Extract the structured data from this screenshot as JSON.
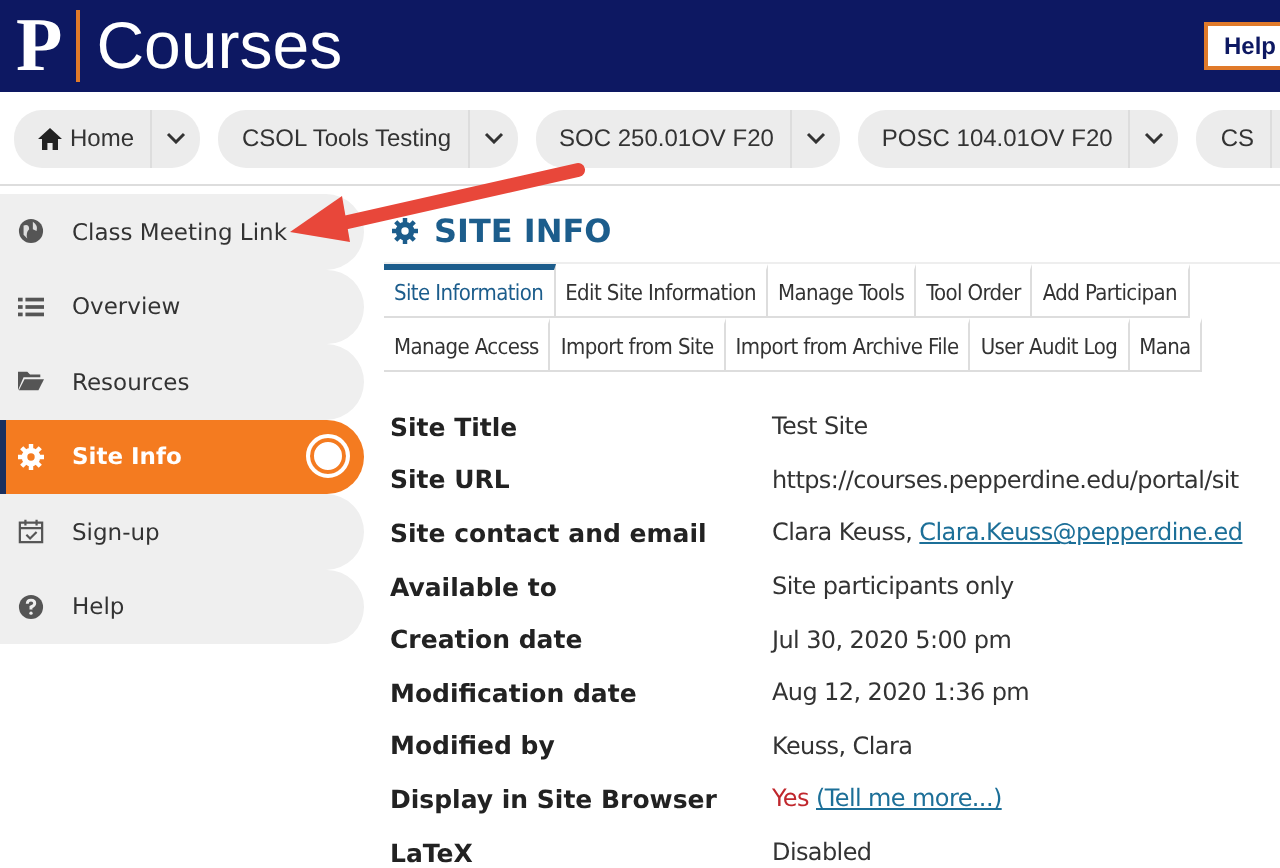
{
  "header": {
    "logo_letter": "P",
    "title": "Courses",
    "help_button": "Help"
  },
  "breadcrumbs": [
    {
      "label": "Home",
      "kind": "home"
    },
    {
      "label": "CSOL Tools Testing",
      "kind": "site"
    },
    {
      "label": "SOC 250.01OV F20",
      "kind": "site"
    },
    {
      "label": "POSC 104.01OV F20",
      "kind": "site"
    },
    {
      "label": "CS",
      "kind": "site"
    }
  ],
  "sidebar": {
    "items": [
      {
        "label": "Class Meeting Link",
        "kind": "globe",
        "selected": false
      },
      {
        "label": "Overview",
        "kind": "list",
        "selected": false
      },
      {
        "label": "Resources",
        "kind": "folder",
        "selected": false
      },
      {
        "label": "Site Info",
        "kind": "gear",
        "selected": true
      },
      {
        "label": "Sign-up",
        "kind": "calendar",
        "selected": false
      },
      {
        "label": "Help",
        "kind": "question",
        "selected": false
      }
    ]
  },
  "page": {
    "title": "SITE INFO",
    "tab_rows": [
      [
        {
          "label": "Site Information",
          "selected": true
        },
        {
          "label": "Edit Site Information",
          "selected": false
        },
        {
          "label": "Manage Tools",
          "selected": false
        },
        {
          "label": "Tool Order",
          "selected": false
        },
        {
          "label": "Add Participan",
          "selected": false
        }
      ],
      [
        {
          "label": "Manage Access",
          "selected": false
        },
        {
          "label": "Import from Site",
          "selected": false
        },
        {
          "label": "Import from Archive File",
          "selected": false
        },
        {
          "label": "User Audit Log",
          "selected": false
        },
        {
          "label": "Mana",
          "selected": false
        }
      ]
    ],
    "details": [
      {
        "label": "Site Title",
        "kind": "text",
        "value": "Test Site"
      },
      {
        "label": "Site URL",
        "kind": "text",
        "value": "https://courses.pepperdine.edu/portal/sit"
      },
      {
        "label": "Site contact and email",
        "kind": "contact",
        "value": "Clara Keuss,",
        "link": "Clara.Keuss@pepperdine.ed"
      },
      {
        "label": "Available to",
        "kind": "text",
        "value": "Site participants only"
      },
      {
        "label": "Creation date",
        "kind": "text",
        "value": "Jul 30, 2020 5:00 pm"
      },
      {
        "label": "Modification date",
        "kind": "text",
        "value": "Aug 12, 2020 1:36 pm"
      },
      {
        "label": "Modified by",
        "kind": "text",
        "value": "Keuss, Clara"
      },
      {
        "label": "Display in Site Browser",
        "kind": "flag",
        "value": "Yes",
        "link": "(Tell me more...)"
      },
      {
        "label": "LaTeX",
        "kind": "text",
        "value": "Disabled"
      }
    ]
  }
}
